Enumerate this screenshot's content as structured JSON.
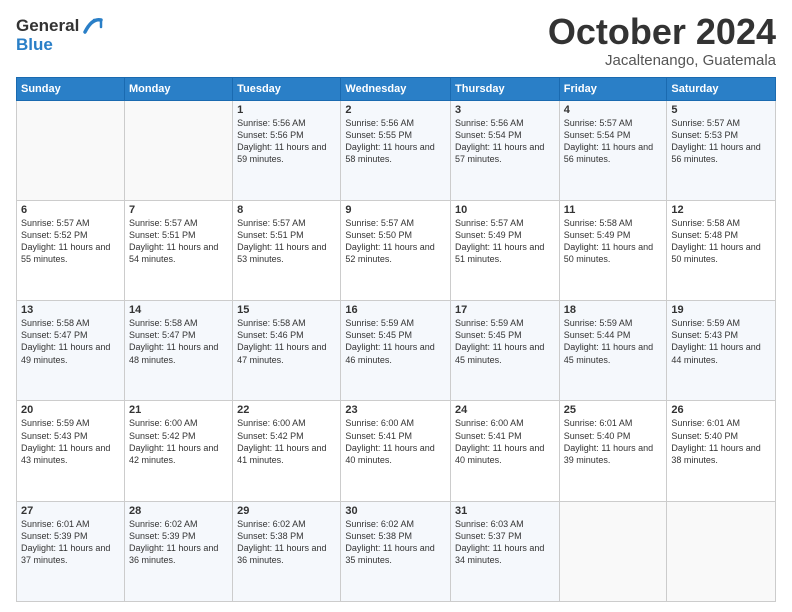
{
  "header": {
    "logo": {
      "line1": "General",
      "line2": "Blue"
    },
    "title": "October 2024",
    "location": "Jacaltenango, Guatemala"
  },
  "calendar": {
    "days_of_week": [
      "Sunday",
      "Monday",
      "Tuesday",
      "Wednesday",
      "Thursday",
      "Friday",
      "Saturday"
    ],
    "weeks": [
      [
        {
          "day": "",
          "sunrise": "",
          "sunset": "",
          "daylight": ""
        },
        {
          "day": "",
          "sunrise": "",
          "sunset": "",
          "daylight": ""
        },
        {
          "day": "1",
          "sunrise": "Sunrise: 5:56 AM",
          "sunset": "Sunset: 5:56 PM",
          "daylight": "Daylight: 11 hours and 59 minutes."
        },
        {
          "day": "2",
          "sunrise": "Sunrise: 5:56 AM",
          "sunset": "Sunset: 5:55 PM",
          "daylight": "Daylight: 11 hours and 58 minutes."
        },
        {
          "day": "3",
          "sunrise": "Sunrise: 5:56 AM",
          "sunset": "Sunset: 5:54 PM",
          "daylight": "Daylight: 11 hours and 57 minutes."
        },
        {
          "day": "4",
          "sunrise": "Sunrise: 5:57 AM",
          "sunset": "Sunset: 5:54 PM",
          "daylight": "Daylight: 11 hours and 56 minutes."
        },
        {
          "day": "5",
          "sunrise": "Sunrise: 5:57 AM",
          "sunset": "Sunset: 5:53 PM",
          "daylight": "Daylight: 11 hours and 56 minutes."
        }
      ],
      [
        {
          "day": "6",
          "sunrise": "Sunrise: 5:57 AM",
          "sunset": "Sunset: 5:52 PM",
          "daylight": "Daylight: 11 hours and 55 minutes."
        },
        {
          "day": "7",
          "sunrise": "Sunrise: 5:57 AM",
          "sunset": "Sunset: 5:51 PM",
          "daylight": "Daylight: 11 hours and 54 minutes."
        },
        {
          "day": "8",
          "sunrise": "Sunrise: 5:57 AM",
          "sunset": "Sunset: 5:51 PM",
          "daylight": "Daylight: 11 hours and 53 minutes."
        },
        {
          "day": "9",
          "sunrise": "Sunrise: 5:57 AM",
          "sunset": "Sunset: 5:50 PM",
          "daylight": "Daylight: 11 hours and 52 minutes."
        },
        {
          "day": "10",
          "sunrise": "Sunrise: 5:57 AM",
          "sunset": "Sunset: 5:49 PM",
          "daylight": "Daylight: 11 hours and 51 minutes."
        },
        {
          "day": "11",
          "sunrise": "Sunrise: 5:58 AM",
          "sunset": "Sunset: 5:49 PM",
          "daylight": "Daylight: 11 hours and 50 minutes."
        },
        {
          "day": "12",
          "sunrise": "Sunrise: 5:58 AM",
          "sunset": "Sunset: 5:48 PM",
          "daylight": "Daylight: 11 hours and 50 minutes."
        }
      ],
      [
        {
          "day": "13",
          "sunrise": "Sunrise: 5:58 AM",
          "sunset": "Sunset: 5:47 PM",
          "daylight": "Daylight: 11 hours and 49 minutes."
        },
        {
          "day": "14",
          "sunrise": "Sunrise: 5:58 AM",
          "sunset": "Sunset: 5:47 PM",
          "daylight": "Daylight: 11 hours and 48 minutes."
        },
        {
          "day": "15",
          "sunrise": "Sunrise: 5:58 AM",
          "sunset": "Sunset: 5:46 PM",
          "daylight": "Daylight: 11 hours and 47 minutes."
        },
        {
          "day": "16",
          "sunrise": "Sunrise: 5:59 AM",
          "sunset": "Sunset: 5:45 PM",
          "daylight": "Daylight: 11 hours and 46 minutes."
        },
        {
          "day": "17",
          "sunrise": "Sunrise: 5:59 AM",
          "sunset": "Sunset: 5:45 PM",
          "daylight": "Daylight: 11 hours and 45 minutes."
        },
        {
          "day": "18",
          "sunrise": "Sunrise: 5:59 AM",
          "sunset": "Sunset: 5:44 PM",
          "daylight": "Daylight: 11 hours and 45 minutes."
        },
        {
          "day": "19",
          "sunrise": "Sunrise: 5:59 AM",
          "sunset": "Sunset: 5:43 PM",
          "daylight": "Daylight: 11 hours and 44 minutes."
        }
      ],
      [
        {
          "day": "20",
          "sunrise": "Sunrise: 5:59 AM",
          "sunset": "Sunset: 5:43 PM",
          "daylight": "Daylight: 11 hours and 43 minutes."
        },
        {
          "day": "21",
          "sunrise": "Sunrise: 6:00 AM",
          "sunset": "Sunset: 5:42 PM",
          "daylight": "Daylight: 11 hours and 42 minutes."
        },
        {
          "day": "22",
          "sunrise": "Sunrise: 6:00 AM",
          "sunset": "Sunset: 5:42 PM",
          "daylight": "Daylight: 11 hours and 41 minutes."
        },
        {
          "day": "23",
          "sunrise": "Sunrise: 6:00 AM",
          "sunset": "Sunset: 5:41 PM",
          "daylight": "Daylight: 11 hours and 40 minutes."
        },
        {
          "day": "24",
          "sunrise": "Sunrise: 6:00 AM",
          "sunset": "Sunset: 5:41 PM",
          "daylight": "Daylight: 11 hours and 40 minutes."
        },
        {
          "day": "25",
          "sunrise": "Sunrise: 6:01 AM",
          "sunset": "Sunset: 5:40 PM",
          "daylight": "Daylight: 11 hours and 39 minutes."
        },
        {
          "day": "26",
          "sunrise": "Sunrise: 6:01 AM",
          "sunset": "Sunset: 5:40 PM",
          "daylight": "Daylight: 11 hours and 38 minutes."
        }
      ],
      [
        {
          "day": "27",
          "sunrise": "Sunrise: 6:01 AM",
          "sunset": "Sunset: 5:39 PM",
          "daylight": "Daylight: 11 hours and 37 minutes."
        },
        {
          "day": "28",
          "sunrise": "Sunrise: 6:02 AM",
          "sunset": "Sunset: 5:39 PM",
          "daylight": "Daylight: 11 hours and 36 minutes."
        },
        {
          "day": "29",
          "sunrise": "Sunrise: 6:02 AM",
          "sunset": "Sunset: 5:38 PM",
          "daylight": "Daylight: 11 hours and 36 minutes."
        },
        {
          "day": "30",
          "sunrise": "Sunrise: 6:02 AM",
          "sunset": "Sunset: 5:38 PM",
          "daylight": "Daylight: 11 hours and 35 minutes."
        },
        {
          "day": "31",
          "sunrise": "Sunrise: 6:03 AM",
          "sunset": "Sunset: 5:37 PM",
          "daylight": "Daylight: 11 hours and 34 minutes."
        },
        {
          "day": "",
          "sunrise": "",
          "sunset": "",
          "daylight": ""
        },
        {
          "day": "",
          "sunrise": "",
          "sunset": "",
          "daylight": ""
        }
      ]
    ]
  }
}
